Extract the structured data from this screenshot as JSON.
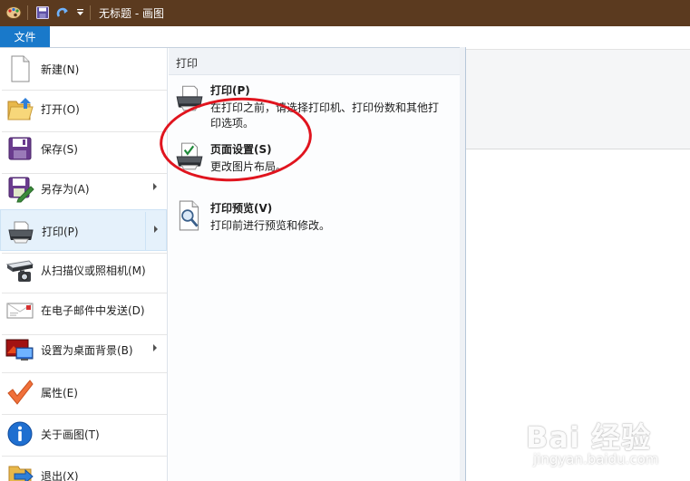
{
  "window": {
    "title": "无标题 - 画图"
  },
  "ribbon": {
    "file_tab": "文件"
  },
  "file_menu": {
    "items": [
      {
        "label": "新建(N)",
        "icon": "new-document-icon",
        "has_submenu": false
      },
      {
        "label": "打开(O)",
        "icon": "open-folder-icon",
        "has_submenu": false
      },
      {
        "label": "保存(S)",
        "icon": "save-disk-icon",
        "has_submenu": false
      },
      {
        "label": "另存为(A)",
        "icon": "save-as-icon",
        "has_submenu": true
      },
      {
        "label": "打印(P)",
        "icon": "printer-icon",
        "has_submenu": true,
        "active": true
      },
      {
        "label": "从扫描仪或照相机(M)",
        "icon": "scanner-camera-icon",
        "has_submenu": false
      },
      {
        "label": "在电子邮件中发送(D)",
        "icon": "email-envelope-icon",
        "has_submenu": false
      },
      {
        "label": "设置为桌面背景(B)",
        "icon": "desktop-background-icon",
        "has_submenu": true
      },
      {
        "label": "属性(E)",
        "icon": "checkmark-icon",
        "has_submenu": false
      },
      {
        "label": "关于画图(T)",
        "icon": "info-icon",
        "has_submenu": false
      },
      {
        "label": "退出(X)",
        "icon": "exit-icon",
        "has_submenu": false
      }
    ]
  },
  "print_submenu": {
    "header": "打印",
    "options": [
      {
        "title": "打印(P)",
        "desc": "在打印之前，请选择打印机、打印份数和其他打印选项。",
        "icon": "printer-icon"
      },
      {
        "title": "页面设置(S)",
        "desc": "更改图片布局。",
        "icon": "page-setup-icon"
      },
      {
        "title": "打印预览(V)",
        "desc": "打印前进行预览和修改。",
        "icon": "print-preview-icon"
      }
    ]
  },
  "watermark": {
    "brand": "Bai 经验",
    "url": "jingyan.baidu.com"
  },
  "colors": {
    "titlebar": "#5b3a1f",
    "file_tab": "#1979ca",
    "hover": "#e5f1fb",
    "annotation": "#e0141e"
  }
}
